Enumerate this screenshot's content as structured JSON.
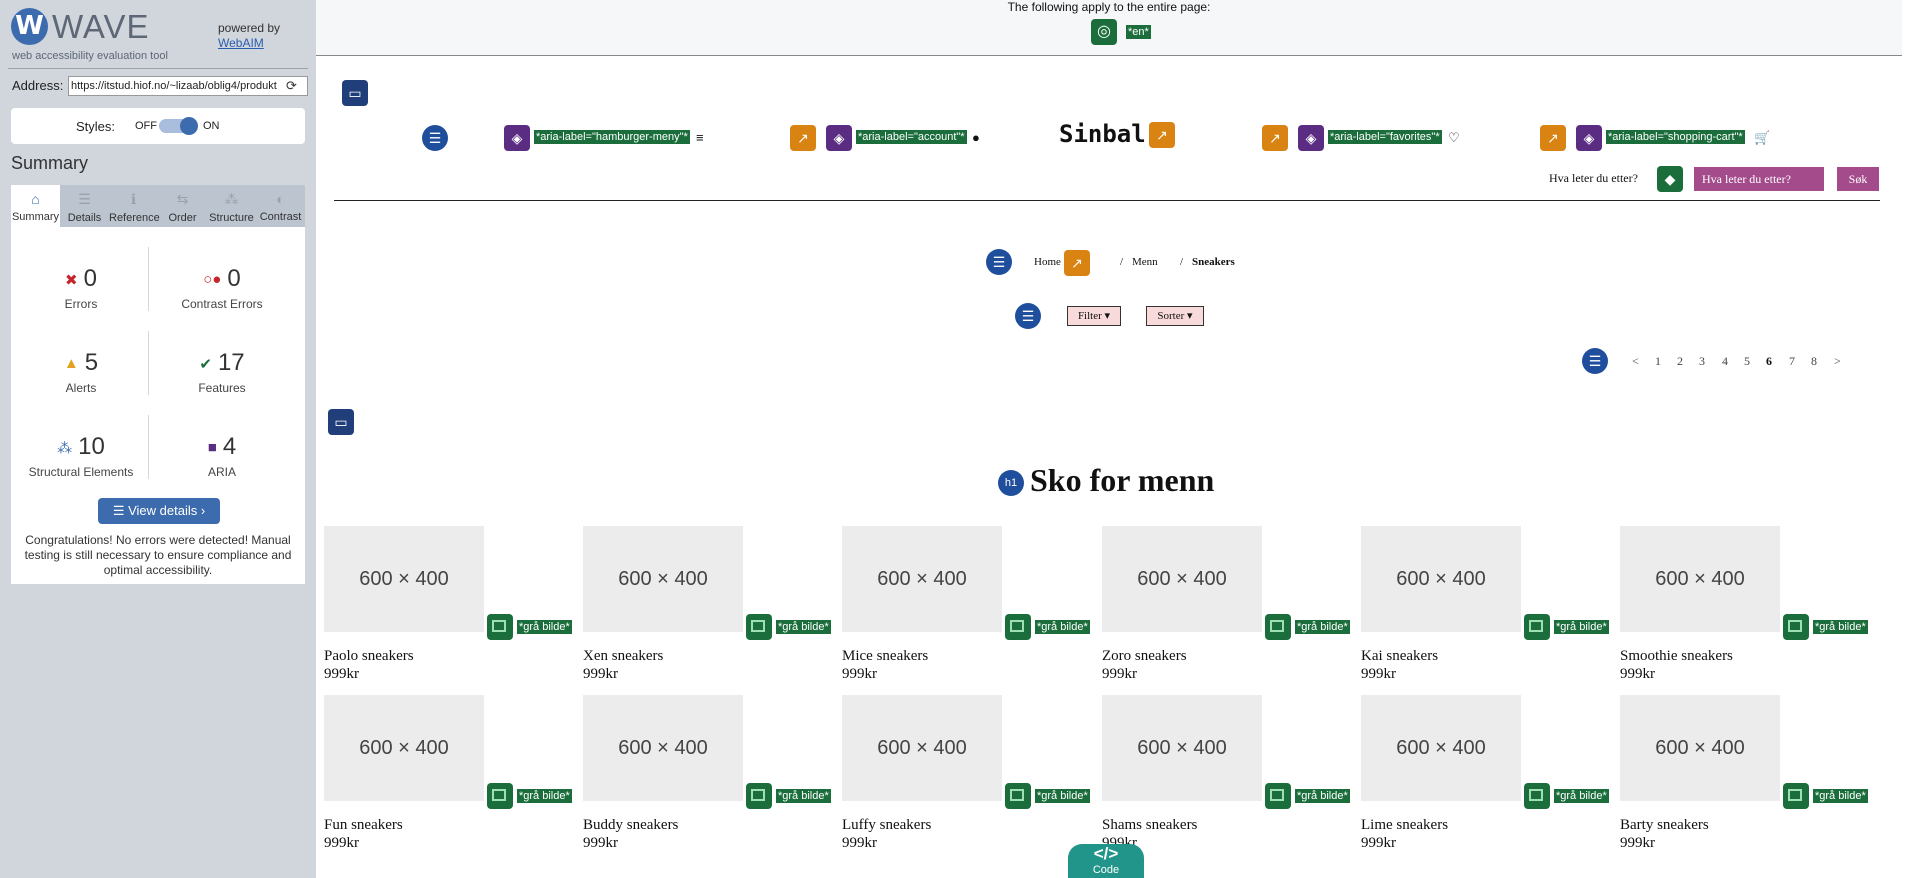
{
  "wave": {
    "logo_letter": "W",
    "title": "WAVE",
    "tagline": "web accessibility evaluation tool",
    "powered_by": "powered by",
    "webaim": "WebAIM",
    "address_label": "Address:",
    "address_value": "https://itstud.hiof.no/~lizaab/oblig4/produkt",
    "styles_label": "Styles:",
    "styles_off": "OFF",
    "styles_on": "ON",
    "summary_heading": "Summary",
    "tabs": [
      {
        "label": "Summary",
        "icon": "home-icon",
        "glyph": "⌂"
      },
      {
        "label": "Details",
        "icon": "list-icon",
        "glyph": "☰"
      },
      {
        "label": "Reference",
        "icon": "info-icon",
        "glyph": "ℹ"
      },
      {
        "label": "Order",
        "icon": "order-icon",
        "glyph": "⇆"
      },
      {
        "label": "Structure",
        "icon": "structure-icon",
        "glyph": "⁂"
      },
      {
        "label": "Contrast",
        "icon": "contrast-icon",
        "glyph": "◐"
      }
    ],
    "stats": {
      "errors": {
        "value": "0",
        "label": "Errors",
        "color": "#c4262e"
      },
      "contrast_errors": {
        "value": "0",
        "label": "Contrast Errors",
        "color": "#c4262e"
      },
      "alerts": {
        "value": "5",
        "label": "Alerts",
        "color": "#e4a11b"
      },
      "features": {
        "value": "17",
        "label": "Features",
        "color": "#1b6e3c"
      },
      "structural": {
        "value": "10",
        "label": "Structural Elements",
        "color": "#3d6cae"
      },
      "aria": {
        "value": "4",
        "label": "ARIA",
        "color": "#5a2d82"
      }
    },
    "view_details": "View details ›",
    "congrats": "Congratulations! No errors were detected! Manual testing is still necessary to ensure compliance and optimal accessibility."
  },
  "page": {
    "applies_text": "The following apply to the entire page:",
    "lang_tag": "*en*",
    "nav_tags": {
      "hamburger": "*aria-label=\"hamburger-meny\"*",
      "account": "*aria-label=\"account\"*",
      "favorites": "*aria-label=\"favorites\"*",
      "cart": "*aria-label=\"shopping-cart\"*"
    },
    "brand": "Sinbal",
    "search_label": "Hva leter du etter?",
    "search_placeholder": "Hva leter du etter?",
    "search_button": "Søk",
    "breadcrumb": {
      "home": "Home",
      "sep": "/",
      "men": "Menn",
      "current": "Sneakers"
    },
    "filter": "Filter",
    "sort": "Sorter",
    "pagination": [
      "<",
      "1",
      "2",
      "3",
      "4",
      "5",
      "6",
      "7",
      "8",
      ">"
    ],
    "current_page": "6",
    "h1_badge": "h1",
    "heading": "Sko for menn",
    "placeholder_text": "600 × 400",
    "img_tag": "*grå bilde*",
    "products": [
      {
        "name": "Paolo sneakers",
        "price": "999kr"
      },
      {
        "name": "Xen sneakers",
        "price": "999kr"
      },
      {
        "name": "Mice sneakers",
        "price": "999kr"
      },
      {
        "name": "Zoro sneakers",
        "price": "999kr"
      },
      {
        "name": "Kai sneakers",
        "price": "999kr"
      },
      {
        "name": "Smoothie sneakers",
        "price": "999kr"
      },
      {
        "name": "Fun sneakers",
        "price": "999kr"
      },
      {
        "name": "Buddy sneakers",
        "price": "999kr"
      },
      {
        "name": "Luffy sneakers",
        "price": "999kr"
      },
      {
        "name": "Shams sneakers",
        "price": "999kr"
      },
      {
        "name": "Lime sneakers",
        "price": "999kr"
      },
      {
        "name": "Barty sneakers",
        "price": "999kr"
      }
    ],
    "code_button": "Code",
    "code_glyph": "</>"
  }
}
